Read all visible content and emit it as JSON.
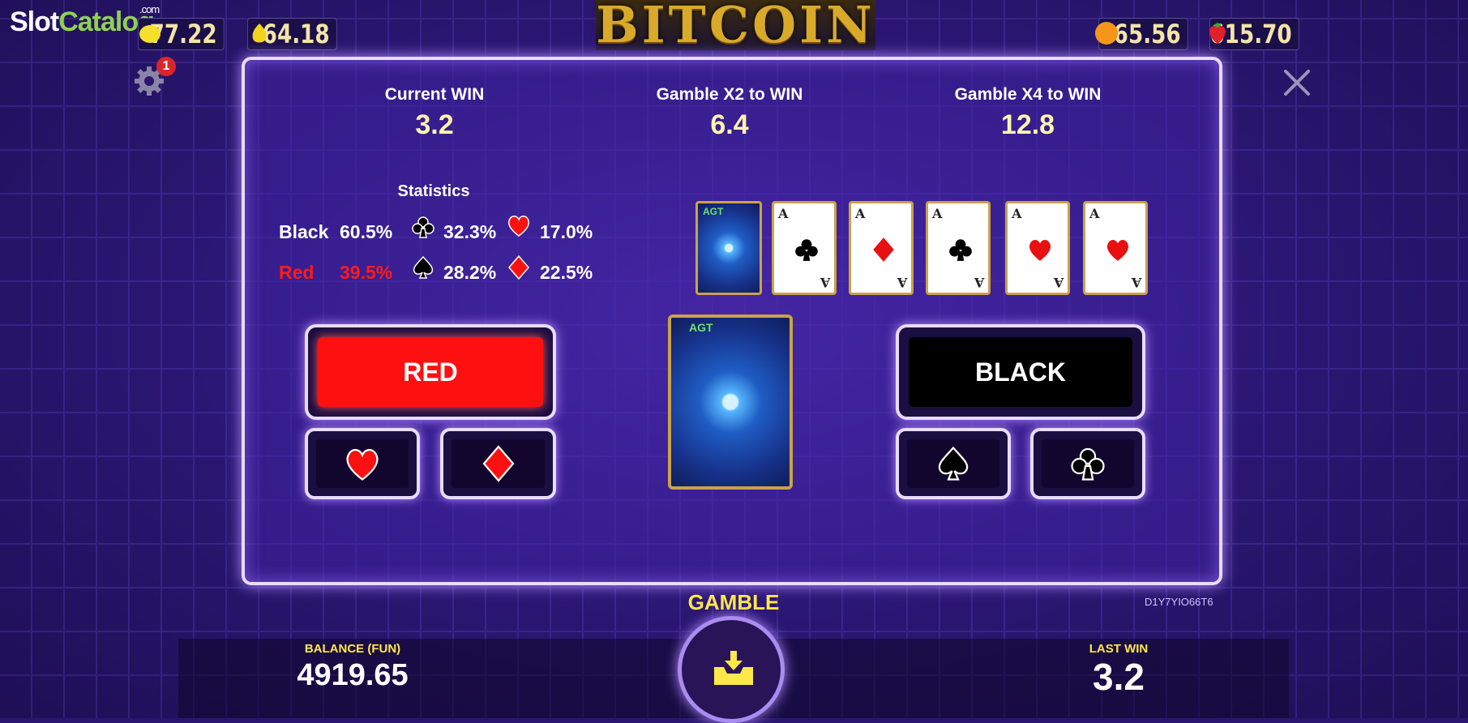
{
  "watermark": {
    "part1": "Slot",
    "part2": "Catalog",
    "suffix": ".com"
  },
  "game_title": "BITCOIN",
  "jackpots": [
    {
      "icon": "lemon-icon",
      "value": "77.22"
    },
    {
      "icon": "pear-icon",
      "value": "64.18"
    },
    {
      "icon": "orange-icon",
      "value": "165.56"
    },
    {
      "icon": "strawberry-icon",
      "value": "615.70"
    }
  ],
  "settings_badge": "1",
  "wins": {
    "current": {
      "label": "Current WIN",
      "value": "3.2"
    },
    "x2": {
      "label": "Gamble X2 to WIN",
      "value": "6.4"
    },
    "x4": {
      "label": "Gamble X4 to WIN",
      "value": "12.8"
    }
  },
  "statistics": {
    "title": "Statistics",
    "black_label": "Black",
    "black_pct": "60.5%",
    "red_label": "Red",
    "red_pct": "39.5%",
    "clubs_pct": "32.3%",
    "hearts_pct": "17.0%",
    "spades_pct": "28.2%",
    "diamonds_pct": "22.5%"
  },
  "history_cards": [
    {
      "rank": "",
      "suit": "back"
    },
    {
      "rank": "A",
      "suit": "clubs"
    },
    {
      "rank": "A",
      "suit": "diamonds"
    },
    {
      "rank": "A",
      "suit": "clubs"
    },
    {
      "rank": "A",
      "suit": "hearts"
    },
    {
      "rank": "A",
      "suit": "hearts"
    }
  ],
  "card_brand": "AGT",
  "buttons": {
    "red": "RED",
    "black": "BLACK"
  },
  "gamble_label": "GAMBLE",
  "session_code": "D1Y7YIO66T6",
  "balance": {
    "label": "BALANCE (FUN)",
    "value": "4919.65"
  },
  "last_win": {
    "label": "LAST WIN",
    "value": "3.2"
  },
  "colors": {
    "red_button": "#ff1010",
    "accent_yellow": "#ffe84a",
    "panel_border": "#e8dcff"
  }
}
